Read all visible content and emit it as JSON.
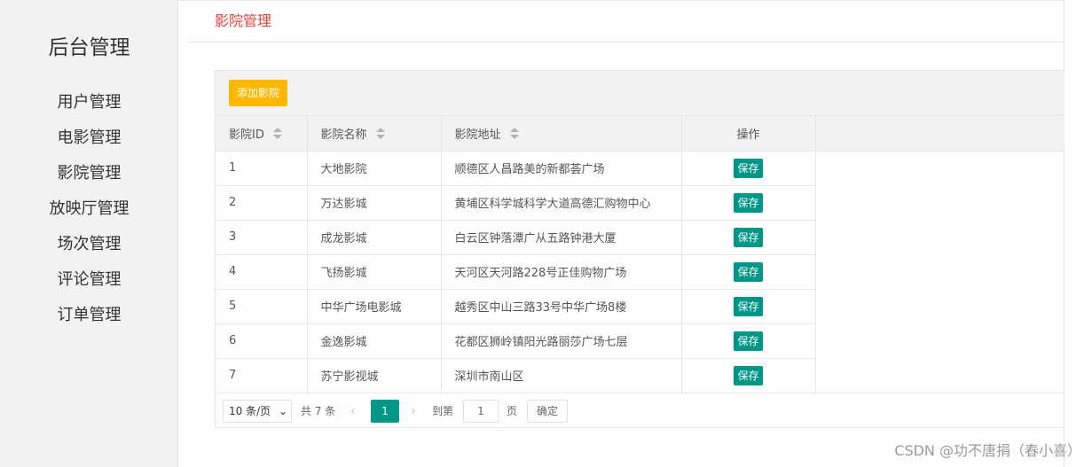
{
  "sidebar": {
    "brand": "后台管理",
    "items": [
      {
        "label": "用户管理"
      },
      {
        "label": "电影管理"
      },
      {
        "label": "影院管理"
      },
      {
        "label": "放映厅管理"
      },
      {
        "label": "场次管理"
      },
      {
        "label": "评论管理"
      },
      {
        "label": "订单管理"
      }
    ]
  },
  "page": {
    "title": "影院管理",
    "title_color": "#e0403c"
  },
  "toolbar": {
    "add_label": "添加影院",
    "add_color": "#ffb800"
  },
  "table": {
    "columns": [
      "影院ID",
      "影院名称",
      "影院地址",
      "操作"
    ],
    "rows": [
      {
        "id": "1",
        "name": "大地影院",
        "address": "顺德区人昌路美的新都荟广场",
        "action": "保存"
      },
      {
        "id": "2",
        "name": "万达影城",
        "address": "黄埔区科学城科学大道高德汇购物中心",
        "action": "保存"
      },
      {
        "id": "3",
        "name": "成龙影城",
        "address": "白云区钟落潭广从五路钟港大厦",
        "action": "保存"
      },
      {
        "id": "4",
        "name": "飞扬影城",
        "address": "天河区天河路228号正佳购物广场",
        "action": "保存"
      },
      {
        "id": "5",
        "name": "中华广场电影城",
        "address": "越秀区中山三路33号中华广场8楼",
        "action": "保存"
      },
      {
        "id": "6",
        "name": "金逸影城",
        "address": "花都区狮岭镇阳光路丽莎广场七层",
        "action": "保存"
      },
      {
        "id": "7",
        "name": "苏宁影视城",
        "address": "深圳市南山区",
        "action": "保存"
      }
    ],
    "action_color": "#009688"
  },
  "pager": {
    "limit": "10 条/页",
    "total": "共 7 条",
    "current_page": "1",
    "goto_label": "到第",
    "goto_value": "1",
    "page_word": "页",
    "confirm": "确定"
  },
  "watermark": "CSDN @功不唐捐（春小喜）",
  "icons": {
    "sort": "sort-icon",
    "chevron": "chevron-down-icon",
    "prev": "chevron-left-icon",
    "next": "chevron-right-icon"
  }
}
